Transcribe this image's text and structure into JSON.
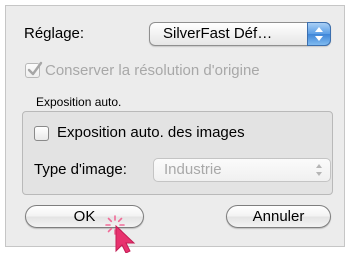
{
  "dialog": {
    "reglage_label": "Réglage:",
    "reglage_value": "SilverFast Déf…",
    "conserver_label": "Conserver la résolution d'origine",
    "conserver_checked": true,
    "conserver_enabled": false,
    "group_title": "Exposition auto.",
    "exposition_label": "Exposition auto. des images",
    "exposition_checked": false,
    "type_label": "Type d'image:",
    "type_value": "Industrie",
    "type_enabled": false,
    "ok_label": "OK",
    "cancel_label": "Annuler"
  },
  "colors": {
    "dialog_bg": "#ececec",
    "popup_accent": "#5a9ee6",
    "cursor": "#e8326e",
    "disabled_text": "#a8a8a8"
  },
  "icons": [
    "popup-arrows-icon",
    "checkmark-icon",
    "mouse-cursor-icon",
    "click-sparkle-icon"
  ]
}
